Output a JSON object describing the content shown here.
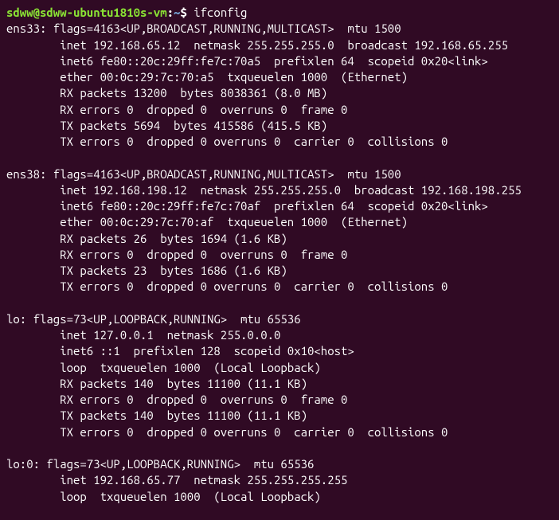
{
  "prompt": {
    "user_host": "sdww@sdww-ubuntu1810s-vm",
    "sep": ":",
    "path": "~",
    "dollar": "$ ",
    "command": "ifconfig"
  },
  "interfaces": [
    {
      "name": "ens33",
      "header": "ens33: flags=4163<UP,BROADCAST,RUNNING,MULTICAST>  mtu 1500",
      "lines": [
        "        inet 192.168.65.12  netmask 255.255.255.0  broadcast 192.168.65.255",
        "        inet6 fe80::20c:29ff:fe7c:70a5  prefixlen 64  scopeid 0x20<link>",
        "        ether 00:0c:29:7c:70:a5  txqueuelen 1000  (Ethernet)",
        "        RX packets 13200  bytes 8038361 (8.0 MB)",
        "        RX errors 0  dropped 0  overruns 0  frame 0",
        "        TX packets 5694  bytes 415586 (415.5 KB)",
        "        TX errors 0  dropped 0 overruns 0  carrier 0  collisions 0"
      ]
    },
    {
      "name": "ens38",
      "header": "ens38: flags=4163<UP,BROADCAST,RUNNING,MULTICAST>  mtu 1500",
      "lines": [
        "        inet 192.168.198.12  netmask 255.255.255.0  broadcast 192.168.198.255",
        "        inet6 fe80::20c:29ff:fe7c:70af  prefixlen 64  scopeid 0x20<link>",
        "        ether 00:0c:29:7c:70:af  txqueuelen 1000  (Ethernet)",
        "        RX packets 26  bytes 1694 (1.6 KB)",
        "        RX errors 0  dropped 0  overruns 0  frame 0",
        "        TX packets 23  bytes 1686 (1.6 KB)",
        "        TX errors 0  dropped 0 overruns 0  carrier 0  collisions 0"
      ]
    },
    {
      "name": "lo",
      "header": "lo: flags=73<UP,LOOPBACK,RUNNING>  mtu 65536",
      "lines": [
        "        inet 127.0.0.1  netmask 255.0.0.0",
        "        inet6 ::1  prefixlen 128  scopeid 0x10<host>",
        "        loop  txqueuelen 1000  (Local Loopback)",
        "        RX packets 140  bytes 11100 (11.1 KB)",
        "        RX errors 0  dropped 0  overruns 0  frame 0",
        "        TX packets 140  bytes 11100 (11.1 KB)",
        "        TX errors 0  dropped 0 overruns 0  carrier 0  collisions 0"
      ]
    },
    {
      "name": "lo:0",
      "header": "lo:0: flags=73<UP,LOOPBACK,RUNNING>  mtu 65536",
      "lines": [
        "        inet 192.168.65.77  netmask 255.255.255.255",
        "        loop  txqueuelen 1000  (Local Loopback)"
      ]
    }
  ]
}
